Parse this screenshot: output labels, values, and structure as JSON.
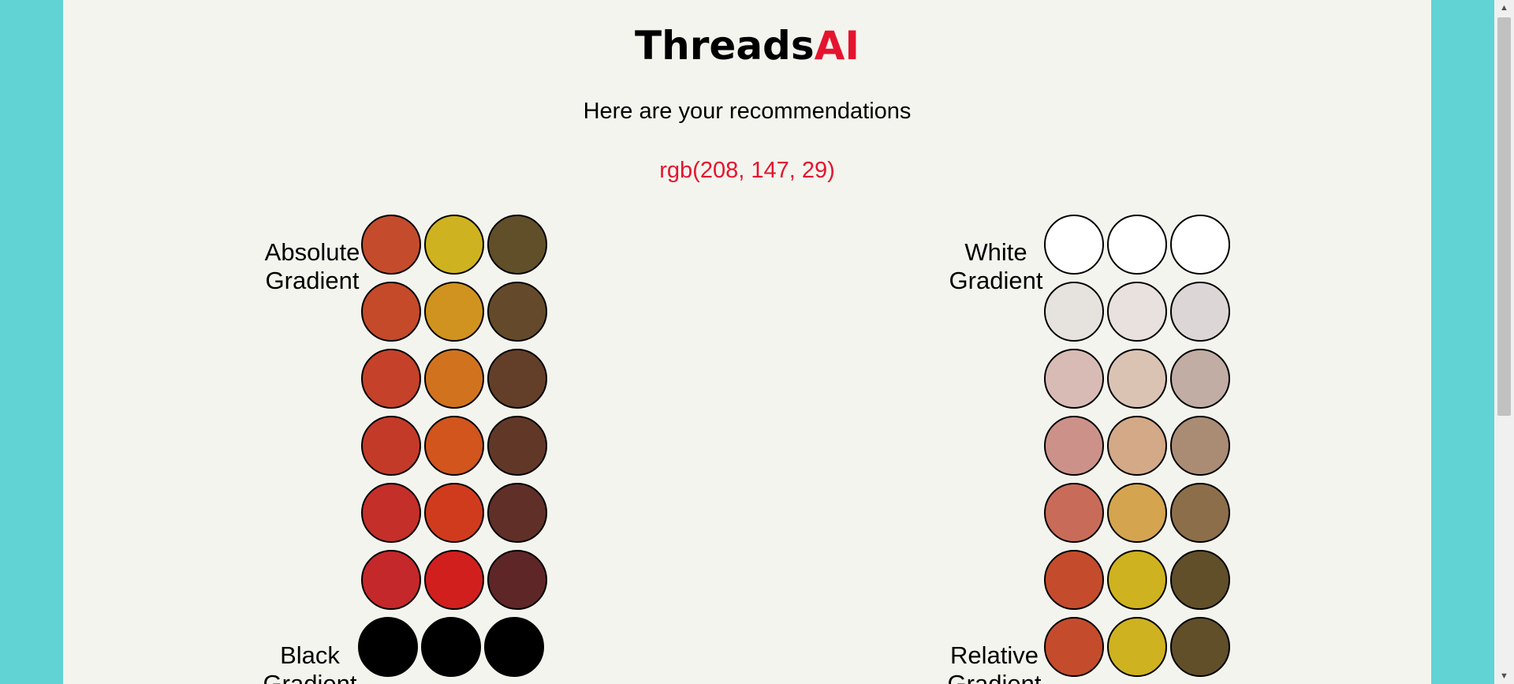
{
  "brand": {
    "part1": "Threads",
    "part2": "AI"
  },
  "subtitle": "Here are your recommendations",
  "selected_color": "rgb(208, 147, 29)",
  "sections": [
    {
      "label_line1": "Absolute",
      "label_line2": "Gradient",
      "rows": [
        [
          "#c44c2c",
          "#cfb21f",
          "#614f2a"
        ],
        [
          "#c44a29",
          "#d0931f",
          "#644a2a"
        ],
        [
          "#c5412a",
          "#d1731e",
          "#633f29"
        ],
        [
          "#c43a29",
          "#d1551d",
          "#613828"
        ],
        [
          "#c42f2a",
          "#d13b1d",
          "#602f28"
        ],
        [
          "#c4282b",
          "#d11f1e",
          "#5f2628"
        ]
      ]
    },
    {
      "label_line1": "White",
      "label_line2": "Gradient",
      "rows": [
        [
          "#ffffff",
          "#ffffff",
          "#ffffff"
        ],
        [
          "#e6e2dd",
          "#e8e1dd",
          "#dcd7d6"
        ],
        [
          "#d9bbb6",
          "#dbc3b4",
          "#c1ada4"
        ],
        [
          "#cc928a",
          "#d3a988",
          "#aa8c75"
        ],
        [
          "#c86c59",
          "#d4a44f",
          "#8c6e4a"
        ],
        [
          "#c44c2c",
          "#cfb21f",
          "#614f2a"
        ]
      ]
    },
    {
      "label_line1": "Black",
      "label_line2": "Gradient",
      "rows": [
        [
          "#000000",
          "#000000",
          "#000000"
        ]
      ]
    },
    {
      "label_line1": "Relative",
      "label_line2": "Gradient",
      "rows": [
        [
          "#c44c2c",
          "#cfb21f",
          "#614f2a"
        ]
      ]
    }
  ],
  "icons": {
    "scroll_up": "triangle-up-icon",
    "scroll_down": "triangle-down-icon"
  }
}
